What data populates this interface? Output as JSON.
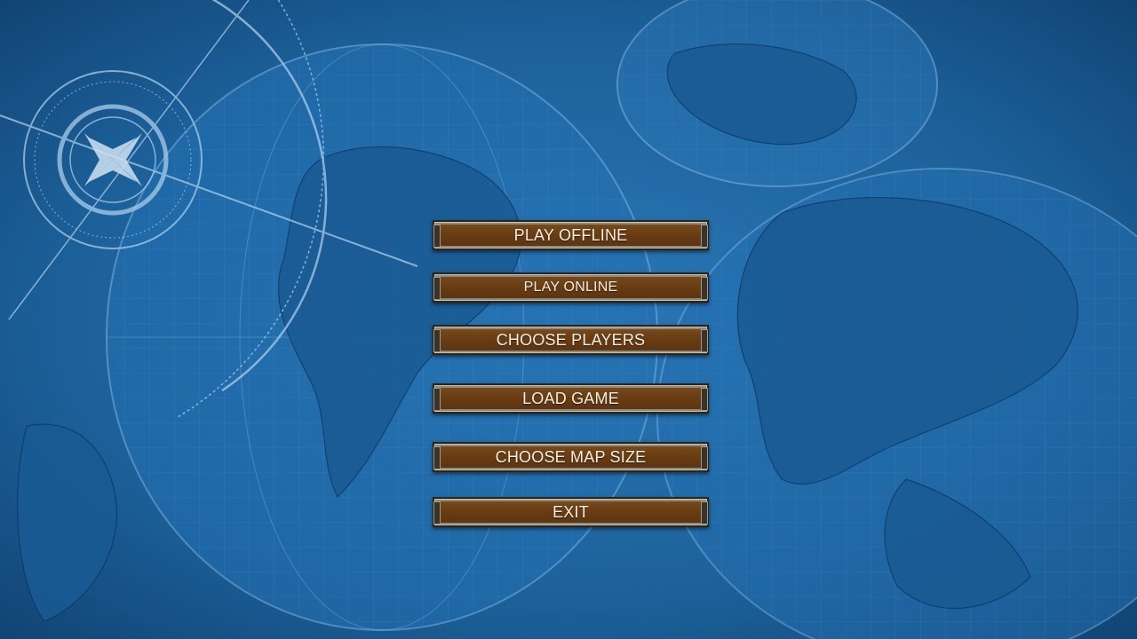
{
  "menu": {
    "buttons": [
      {
        "label": "PLAY OFFLINE"
      },
      {
        "label": "PLAY ONLINE"
      },
      {
        "label": "CHOOSE PLAYERS"
      },
      {
        "label": "LOAD GAME"
      },
      {
        "label": "CHOOSE MAP SIZE"
      },
      {
        "label": "EXIT"
      }
    ]
  },
  "colors": {
    "background": "#1b5d9a",
    "button": "#6b3f14",
    "button_text": "#f4efe4"
  },
  "background_art": "antique-world-map"
}
